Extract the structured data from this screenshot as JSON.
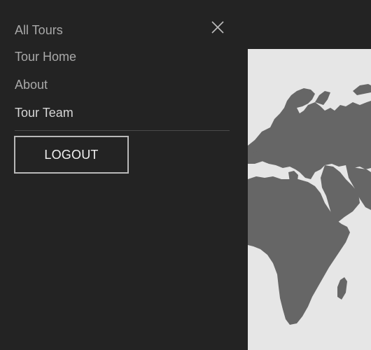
{
  "drawer": {
    "close_icon": "close-icon",
    "nav_items": [
      {
        "label": "All Tours",
        "active": false
      },
      {
        "label": "Tour Home",
        "active": false
      },
      {
        "label": "About",
        "active": false
      },
      {
        "label": "Tour Team",
        "active": true
      }
    ],
    "logout_label": "LOGOUT"
  },
  "background": {
    "map_icon": "world-map-image",
    "colors": {
      "drawer_bg": "#232323",
      "map_land": "#666666",
      "map_sea": "#e6e6e6"
    }
  }
}
